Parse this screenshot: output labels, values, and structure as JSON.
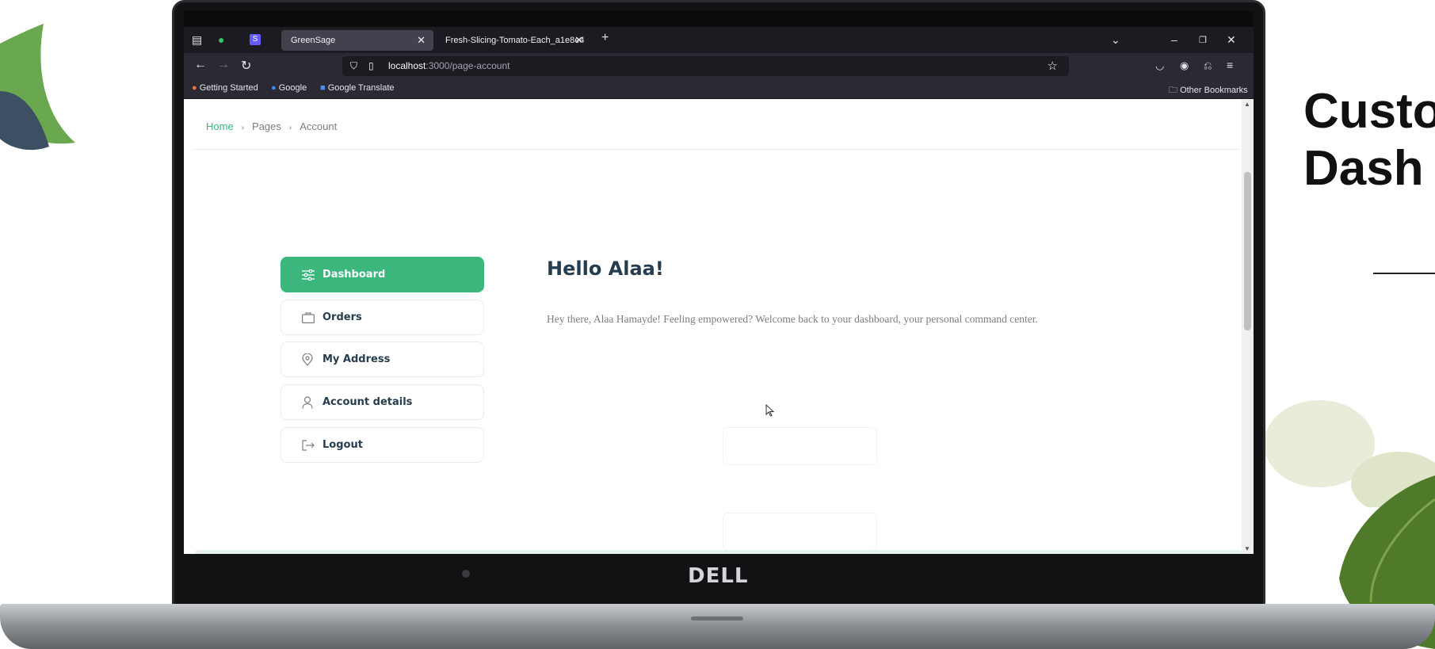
{
  "slide": {
    "title_line1": "Custo",
    "title_line2": "Dash"
  },
  "laptop": {
    "brand": "DELL"
  },
  "browser": {
    "tabs": [
      {
        "label": "GreenSage",
        "active": true
      },
      {
        "label": "Fresh-Slicing-Tomato-Each_a1e8e4",
        "active": false
      }
    ],
    "new_tab": "+",
    "url_host": "localhost",
    "url_path": ":3000/page-account",
    "bookmarks": [
      "Getting Started",
      "Google",
      "Google Translate"
    ],
    "other_bookmarks": "Other Bookmarks"
  },
  "page": {
    "breadcrumb": {
      "home": "Home",
      "pages": "Pages",
      "current": "Account"
    },
    "sidebar": {
      "items": [
        {
          "label": "Dashboard",
          "icon": "sliders-icon",
          "active": true
        },
        {
          "label": "Orders",
          "icon": "bag-icon",
          "active": false
        },
        {
          "label": "My Address",
          "icon": "map-pin-icon",
          "active": false
        },
        {
          "label": "Account details",
          "icon": "user-icon",
          "active": false
        },
        {
          "label": "Logout",
          "icon": "logout-icon",
          "active": false
        }
      ]
    },
    "greeting": "Hello Alaa!",
    "welcome": "Hey there, Alaa Hamayde! Feeling empowered? Welcome back to your dashboard, your personal command center."
  },
  "colors": {
    "brand_green": "#3bb77e",
    "heading": "#253d4e",
    "muted": "#7e7e7e",
    "browser_chrome": "#2b2a33"
  }
}
